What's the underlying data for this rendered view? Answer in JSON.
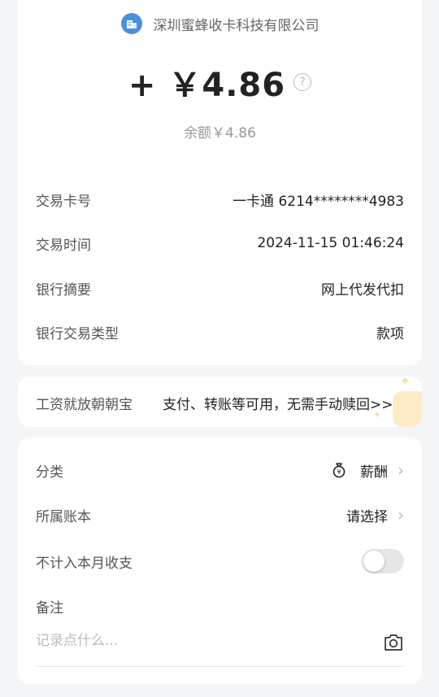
{
  "header": {
    "merchant_name": "深圳蜜蜂收卡科技有限公司",
    "amount": "+ ￥4.86",
    "balance": "余额￥4.86"
  },
  "details": [
    {
      "label": "交易卡号",
      "value": "一卡通 6214********4983"
    },
    {
      "label": "交易时间",
      "value": "2024-11-15 01:46:24"
    },
    {
      "label": "银行摘要",
      "value": "网上代发代扣"
    },
    {
      "label": "银行交易类型",
      "value": "款项"
    }
  ],
  "promo": {
    "label": "工资就放朝朝宝",
    "text": "支付、转账等可用，无需手动赎回>>"
  },
  "settings": {
    "category_label": "分类",
    "category_value": "薪酬",
    "ledger_label": "所属账本",
    "ledger_value": "请选择",
    "exclude_label": "不计入本月收支",
    "exclude_enabled": false,
    "memo_label": "备注",
    "memo_placeholder": "记录点什么..."
  },
  "colors": {
    "background": "#f4f5f7",
    "card": "#ffffff",
    "merchant_icon": "#4a90e2",
    "promo_accent": "#fdebc8"
  },
  "icons": {
    "merchant": "building-icon",
    "help": "question-circle-icon",
    "category": "money-bag-icon",
    "chevron": "chevron-right-icon",
    "camera": "camera-icon"
  }
}
